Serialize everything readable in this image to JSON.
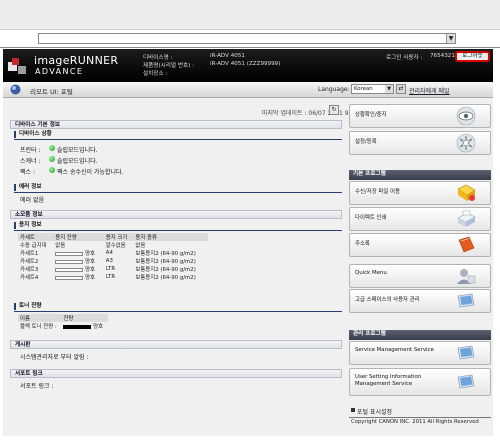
{
  "header": {
    "brand_main": "imageRUNNER",
    "brand_sub": "ADVANCE",
    "device_name_label": "디바이스명 :",
    "device_name_value": "iR-ADV 4051",
    "product_label": "제품명(시리얼 번호) :",
    "product_value": "iR-ADV 4051 (ZZZ99999)",
    "location_label": "설치장소 :",
    "login_user_label": "로그인 사용자 :",
    "login_user_value": "7654321",
    "logout_label": "로그아웃"
  },
  "titlebar": {
    "title": "리모트 UI: 포털",
    "language_label": "Language:",
    "language_value": "Korean",
    "mail_link": "관리자에게 메일"
  },
  "main": {
    "last_updated_label": "마지막 업데이트 : 06/07 2011 9:13:17",
    "device_basic": {
      "title": "디바이스 기본 정보",
      "status_head": "디바이스 상황",
      "rows": [
        {
          "label": "프린터 :",
          "value": "슬립모드입니다."
        },
        {
          "label": "스캐너 :",
          "value": "슬립모드입니다."
        },
        {
          "label": "팩스 :",
          "value": "팩스 송수신이 가능합니다."
        }
      ],
      "error_head": "에러 정보",
      "error_value": "에러 없음"
    },
    "consumables": {
      "title": "소모품 정보",
      "paper_head": "용지 정보",
      "table_header": [
        "카세트",
        "용지 잔량",
        "용지 크기",
        "용지 종류"
      ],
      "rows": [
        {
          "name": "수동 급지대",
          "level": "없음",
          "size": "알수없음",
          "type": "없음"
        },
        {
          "name": "카세트1",
          "level": "양호",
          "size": "A4",
          "type": "보통용지2 (64-90 g/m2)"
        },
        {
          "name": "카세트2",
          "level": "양호",
          "size": "A3",
          "type": "보통용지2 (64-90 g/m2)"
        },
        {
          "name": "카세트3",
          "level": "양호",
          "size": "LTR",
          "type": "보통용지2 (64-90 g/m2)"
        },
        {
          "name": "카세트4",
          "level": "양호",
          "size": "LTR",
          "type": "보통용지2 (64-90 g/m2)"
        }
      ],
      "toner_head": "토너 잔량",
      "toner_header": [
        "이름",
        "잔량"
      ],
      "toner_name": "블랙 토너 잔량 :",
      "toner_value": "양호"
    },
    "board": {
      "title": "게시판",
      "text": "시스템관리자로 부터 알림 :"
    },
    "support": {
      "title": "서포트 링크",
      "text": "서포트 링크 :"
    }
  },
  "sidebar": {
    "top_buttons": [
      {
        "label": "상황확인/중지"
      },
      {
        "label": "설정/등록"
      }
    ],
    "basic_head": "기본 프로그램",
    "basic_buttons": [
      {
        "label": "수신/저장 파일 이용"
      },
      {
        "label": "다이렉트 인쇄"
      },
      {
        "label": "주소록"
      },
      {
        "label": "Quick Menu"
      },
      {
        "label": "고급 스페이스의 사용자 관리"
      }
    ],
    "admin_head": "관리 프로그램",
    "admin_buttons": [
      {
        "label": "Service Management Service"
      },
      {
        "label": "User Setting Information Management Service"
      }
    ],
    "portal_link": "포털 표시설정",
    "copyright": "Copyright CANON INC. 2011 All Rights Reserved"
  },
  "colors": {
    "header_bg": "#000000",
    "logout_border": "#e00000",
    "status_dot": "#1c9c1c",
    "sidebar_head": "#40465a"
  }
}
